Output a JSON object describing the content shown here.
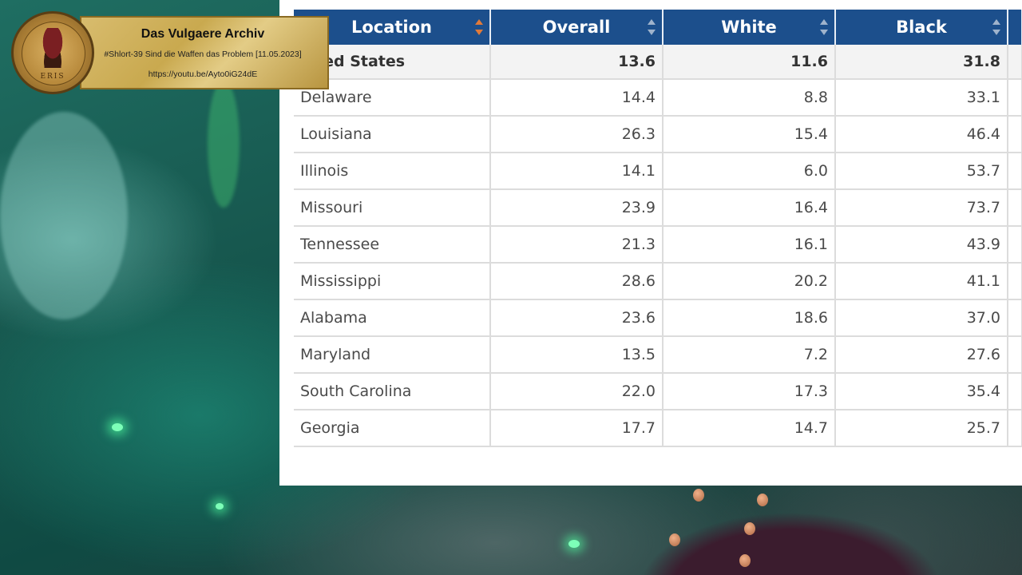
{
  "archive": {
    "title": "Das Vulgaere Archiv",
    "subtitle": "#Shlort-39 Sind die Waffen das Problem [11.05.2023]",
    "url": "https://youtu.be/Ayto0iG24dE",
    "seal_text": "ERIS"
  },
  "table": {
    "headers": {
      "location": "Location",
      "overall": "Overall",
      "white": "White",
      "black": "Black"
    },
    "sort_active": "location",
    "total": {
      "location": "nited States",
      "overall": "13.6",
      "white": "11.6",
      "black": "31.8"
    },
    "rows": [
      {
        "location": "Delaware",
        "overall": "14.4",
        "white": "8.8",
        "black": "33.1"
      },
      {
        "location": "Louisiana",
        "overall": "26.3",
        "white": "15.4",
        "black": "46.4"
      },
      {
        "location": "Illinois",
        "overall": "14.1",
        "white": "6.0",
        "black": "53.7"
      },
      {
        "location": "Missouri",
        "overall": "23.9",
        "white": "16.4",
        "black": "73.7"
      },
      {
        "location": "Tennessee",
        "overall": "21.3",
        "white": "16.1",
        "black": "43.9"
      },
      {
        "location": "Mississippi",
        "overall": "28.6",
        "white": "20.2",
        "black": "41.1"
      },
      {
        "location": "Alabama",
        "overall": "23.6",
        "white": "18.6",
        "black": "37.0"
      },
      {
        "location": "Maryland",
        "overall": "13.5",
        "white": "7.2",
        "black": "27.6"
      },
      {
        "location": "South Carolina",
        "overall": "22.0",
        "white": "17.3",
        "black": "35.4"
      },
      {
        "location": "Georgia",
        "overall": "17.7",
        "white": "14.7",
        "black": "25.7"
      }
    ]
  },
  "colors": {
    "header_bg": "#1c4f8c",
    "sort_active": "#e07a3a",
    "badge_gold": "#d8bc6e"
  }
}
